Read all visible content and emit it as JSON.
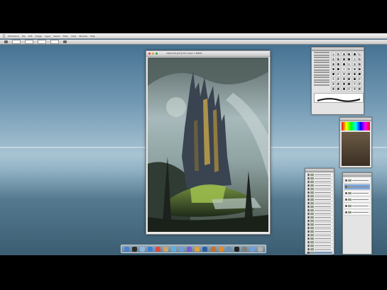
{
  "menubar": {
    "app_menu": "Photoshop",
    "items": [
      "File",
      "Edit",
      "Image",
      "Layer",
      "Select",
      "Filter",
      "View",
      "Window",
      "Help"
    ]
  },
  "document": {
    "title": "castle_final.psd @ 25% (Layer 1, RGB/8)",
    "close_color": "#e0443e",
    "min_color": "#dfa023",
    "max_color": "#29a53a"
  },
  "panels": {
    "brushes": {
      "brush_count": 48
    },
    "swatches": {
      "colors": [
        "#ff0000",
        "#ff8000",
        "#ffff00",
        "#00ff00",
        "#00ffff",
        "#0000ff",
        "#ff00ff",
        "#ffffff",
        "#000000",
        "#7f7f7f",
        "#7f0000",
        "#7f7f00",
        "#007f00",
        "#00007f"
      ]
    },
    "layers": {
      "rows": 24,
      "selected_index": 22
    },
    "channels": {
      "rows": 6
    }
  },
  "dock": {
    "icons": [
      "finder-icon",
      "dashboard-icon",
      "mail-icon",
      "safari-icon",
      "ical-icon",
      "addressbook-icon",
      "itunes-icon",
      "iphoto-icon",
      "imovie-icon",
      "garageband-icon",
      "photoshop-icon",
      "bridge-icon",
      "illustrator-icon",
      "preview-icon",
      "terminal-icon",
      "preferences-icon",
      "folder-icon",
      "trash-icon"
    ],
    "colors": [
      "#4a7fd1",
      "#2c2c2c",
      "#8fb8e0",
      "#3d7fd8",
      "#e04a3f",
      "#c9a46b",
      "#5ab2e0",
      "#6aa0d8",
      "#7a5bd6",
      "#e0a23a",
      "#2d5fa8",
      "#c9702c",
      "#e08c2e",
      "#6b8fb3",
      "#222222",
      "#7f7f7f",
      "#6fa0d8",
      "#b0b0b0"
    ]
  }
}
